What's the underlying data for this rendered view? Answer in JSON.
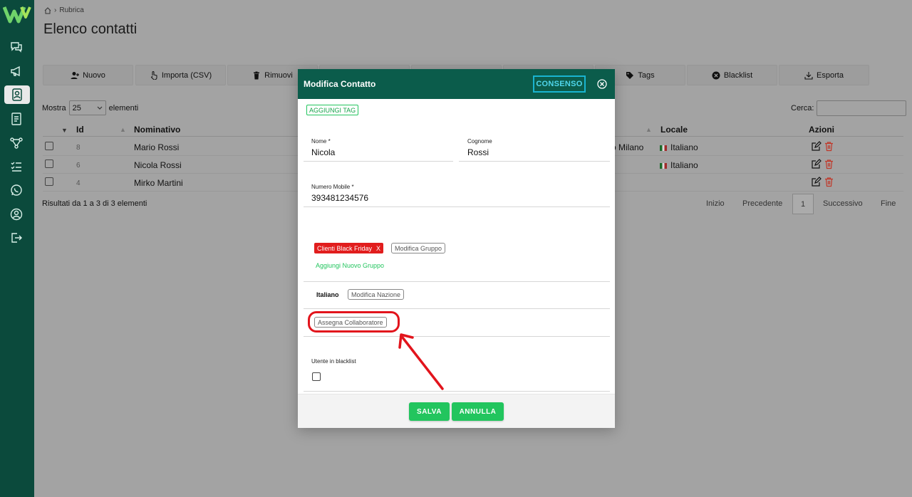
{
  "page": {
    "breadcrumb": "Rubrica",
    "title": "Elenco contatti"
  },
  "toolbar": {
    "nuovo": "Nuovo",
    "importa": "Importa (CSV)",
    "rimuovi": "Rimuovi",
    "tags": "Tags",
    "blacklist": "Blacklist",
    "esporta": "Esporta"
  },
  "table_controls": {
    "mostra": "Mostra",
    "page_size": "25",
    "elementi": "elementi",
    "cerca": "Cerca:"
  },
  "table": {
    "headers": {
      "id": "Id",
      "nominativo": "Nominativo",
      "locale": "Locale",
      "azioni": "Azioni"
    },
    "rows": [
      {
        "id": "8",
        "nominativo": "Mario Rossi",
        "partial": "o Milano",
        "locale": "Italiano"
      },
      {
        "id": "6",
        "nominativo": "Nicola Rossi",
        "partial": "",
        "locale": "Italiano"
      },
      {
        "id": "4",
        "nominativo": "Mirko Martini",
        "partial": "",
        "locale": ""
      }
    ],
    "results": "Risultati da 1 a 3 di 3 elementi"
  },
  "pager": {
    "inizio": "Inizio",
    "precedente": "Precedente",
    "current": "1",
    "successivo": "Successivo",
    "fine": "Fine"
  },
  "modal": {
    "title": "Modifica Contatto",
    "consenso": "CONSENSO",
    "aggiungi_tag": "AGGIUNGI TAG",
    "nome_label": "Nome *",
    "nome_value": "Nicola",
    "cognome_label": "Cognome",
    "cognome_value": "Rossi",
    "mobile_label": "Numero Mobile *",
    "mobile_value": "393481234576",
    "group_tag": "Clienti Black Friday",
    "group_tag_remove": "X",
    "modifica_gruppo": "Modifica Gruppo",
    "aggiungi_gruppo": "Aggiungi Nuovo Gruppo",
    "nazione": "Italiano",
    "modifica_nazione": "Modifica Nazione",
    "assegna_collaboratore": "Assegna Collaboratore",
    "blacklist_label": "Utente in blacklist",
    "salva": "SALVA",
    "annulla": "ANNULLA"
  },
  "colors": {
    "sidebar": "#0b4a3c",
    "modal_header": "#0b5c4b",
    "accent_green": "#22c55e",
    "consenso": "#19b4d0",
    "tag_red": "#e11d1d",
    "highlight": "#e2141c"
  }
}
